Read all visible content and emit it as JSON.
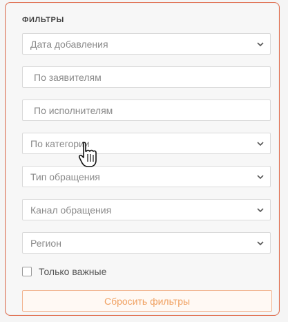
{
  "filters": {
    "title": "ФИЛЬТРЫ",
    "fields": [
      {
        "kind": "select",
        "label": "Дата добавления"
      },
      {
        "kind": "text",
        "label": "По заявителям"
      },
      {
        "kind": "text",
        "label": "По исполнителям"
      },
      {
        "kind": "select",
        "label": "По категории"
      },
      {
        "kind": "select",
        "label": "Тип обращения"
      },
      {
        "kind": "select",
        "label": "Канал обращения"
      },
      {
        "kind": "select",
        "label": "Регион"
      }
    ],
    "important_only_label": "Только важные",
    "important_only_checked": false,
    "reset_label": "Сбросить фильтры"
  },
  "icons": {
    "dropdown": "chevron-down-icon",
    "cursor": "hand-pointer-icon"
  },
  "colors": {
    "accent": "#f0a060",
    "border_accent": "#e06a4a"
  }
}
